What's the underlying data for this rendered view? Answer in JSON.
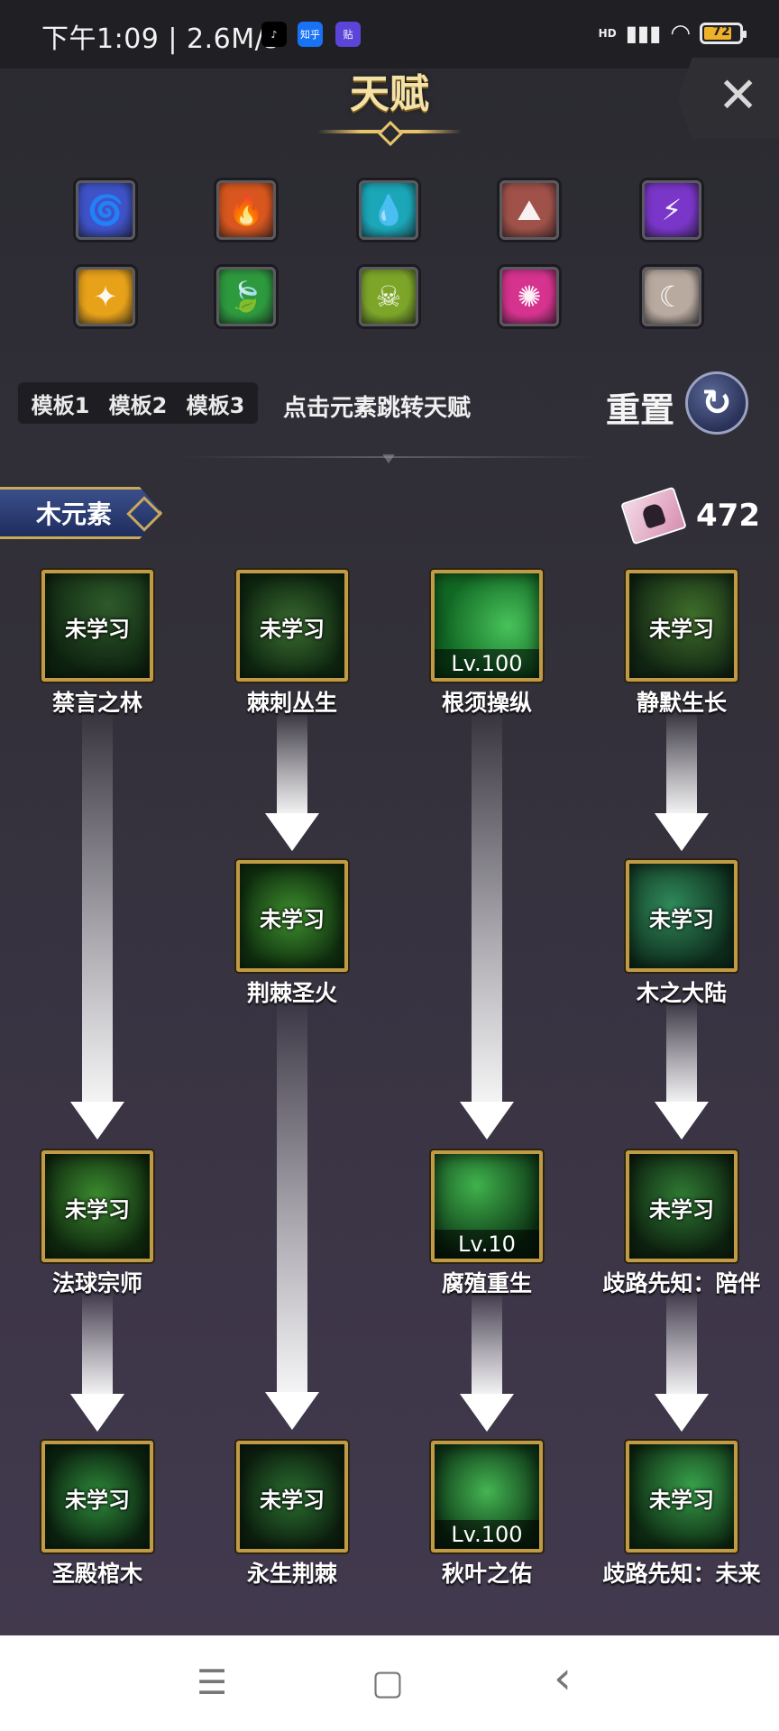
{
  "status_bar": {
    "time_speed": "下午1:09 | 2.6M/s",
    "apps": [
      "tiktok-icon",
      "知乎",
      "贴"
    ],
    "signal": "HD",
    "battery": "72",
    "battery_level": 0.72
  },
  "header": {
    "title": "天赋",
    "close_label": "✕"
  },
  "elements": [
    {
      "name": "wind-element",
      "icon": "🌀",
      "color": "#3f53c9"
    },
    {
      "name": "fire-element",
      "icon": "🔥",
      "color": "#d9571f"
    },
    {
      "name": "water-element",
      "icon": "💧",
      "color": "#1ba7b8"
    },
    {
      "name": "earth-element",
      "icon": "⛰",
      "color": "#a0524a"
    },
    {
      "name": "lightning-element",
      "icon": "⚡",
      "color": "#7a36c9"
    },
    {
      "name": "light-element",
      "icon": "✦",
      "color": "#e8a21a"
    },
    {
      "name": "wood-element",
      "icon": "🍃",
      "color": "#2e9a3e"
    },
    {
      "name": "poison-element",
      "icon": "☠",
      "color": "#7da629"
    },
    {
      "name": "arcane-element",
      "icon": "✺",
      "color": "#d6338f"
    },
    {
      "name": "moon-element",
      "icon": "☾",
      "color": "#b9aaa0"
    }
  ],
  "templates": [
    "模板1",
    "模板2",
    "模板3"
  ],
  "hint": "点击元素跳转天赋",
  "reset_label": "重置",
  "reset_icon": "↻",
  "section": {
    "title": "木元素",
    "points": "472"
  },
  "talents": {
    "r1c1": {
      "name": "禁言之林",
      "status": "未学习",
      "level": ""
    },
    "r1c2": {
      "name": "棘刺丛生",
      "status": "未学习",
      "level": ""
    },
    "r1c3": {
      "name": "根须操纵",
      "status": "",
      "level": "Lv.100"
    },
    "r1c4": {
      "name": "静默生长",
      "status": "未学习",
      "level": ""
    },
    "r2c2": {
      "name": "荆棘圣火",
      "status": "未学习",
      "level": ""
    },
    "r2c4": {
      "name": "木之大陆",
      "status": "未学习",
      "level": ""
    },
    "r3c1": {
      "name": "法球宗师",
      "status": "未学习",
      "level": ""
    },
    "r3c3": {
      "name": "腐殖重生",
      "status": "",
      "level": "Lv.10"
    },
    "r3c4": {
      "name": "歧路先知：陪伴",
      "status": "未学习",
      "level": ""
    },
    "r4c1": {
      "name": "圣殿棺木",
      "status": "未学习",
      "level": ""
    },
    "r4c2": {
      "name": "永生荆棘",
      "status": "未学习",
      "level": ""
    },
    "r4c3": {
      "name": "秋叶之佑",
      "status": "",
      "level": "Lv.100"
    },
    "r4c4": {
      "name": "歧路先知：未来",
      "status": "未学习",
      "level": ""
    }
  },
  "nav": {
    "menu": "☰",
    "home": "▢",
    "back": "‹"
  }
}
